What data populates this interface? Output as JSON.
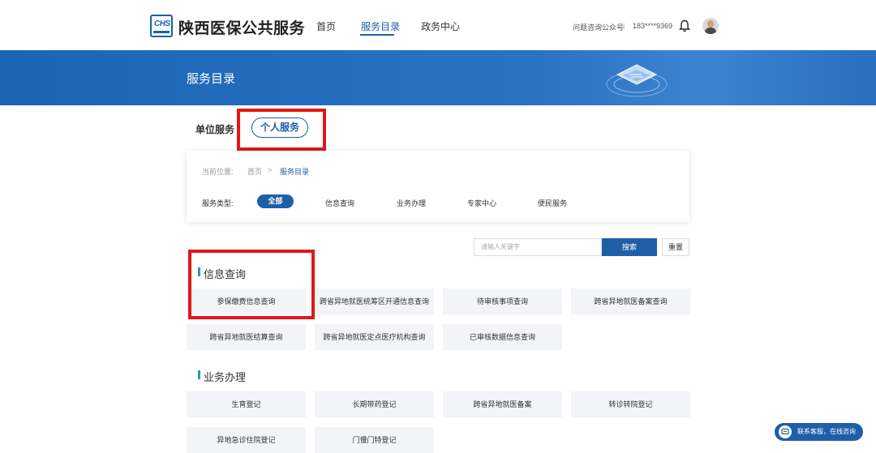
{
  "header": {
    "logo_text": "CHS",
    "brand": "陕西医保公共服务",
    "nav": [
      "首页",
      "服务目录",
      "政务中心"
    ],
    "nav_active": "服务目录",
    "wechat": "问题咨询公众号",
    "separator": "|",
    "phone": "183****9369",
    "icons": [
      "bell-icon",
      "avatar"
    ]
  },
  "banner": {
    "title": "服务目录",
    "colors": {
      "primary": "#1e5fa8"
    }
  },
  "service_tabs": {
    "unit": "单位服务",
    "personal": "个人服务"
  },
  "breadcrumb": {
    "label": "当前位置:",
    "home": "首页",
    "sep": ">",
    "current": "服务目录"
  },
  "filters": {
    "label": "服务类型:",
    "all": "全部",
    "options": [
      "信息查询",
      "业务办理",
      "专家中心",
      "便民服务"
    ]
  },
  "search": {
    "placeholder": "请输入关键字",
    "button": "搜索",
    "reset": "重置"
  },
  "sections": [
    {
      "title": "信息查询",
      "items": [
        "参保缴费信息查询",
        "跨省异地就医统筹区开通信息查询",
        "待审核事项查询",
        "跨省异地就医备案查询",
        "跨省异地就医结算查询",
        "跨省异地就医定点医疗机构查询",
        "已审核数据信息查询"
      ]
    },
    {
      "title": "业务办理",
      "items": [
        "生育登记",
        "长期带药登记",
        "跨省异地就医备案",
        "转诊转院登记",
        "异地急诊住院登记",
        "门慢门特登记"
      ]
    }
  ],
  "chat": {
    "label": "联系客服，在线咨询"
  }
}
